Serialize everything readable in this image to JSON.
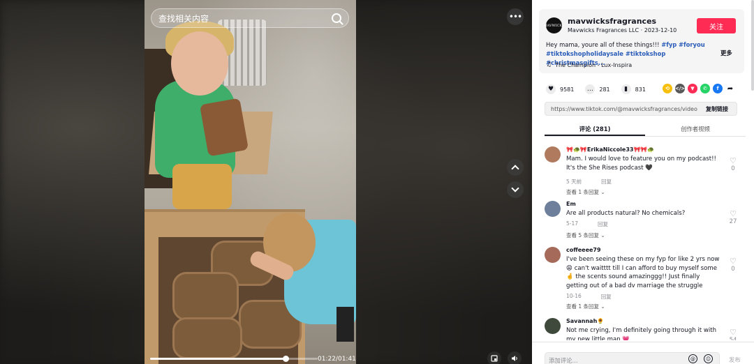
{
  "search": {
    "placeholder": "查找相关内容"
  },
  "player": {
    "time": "01:22/01:41",
    "progress_fraction": 0.81,
    "more_icon": "ellipsis-icon",
    "prev_icon": "chevron-up-icon",
    "next_icon": "chevron-down-icon",
    "pip_icon": "picture-in-picture-icon",
    "volume_icon": "speaker-icon"
  },
  "author": {
    "avatar_text": "MAVWICKS",
    "name": "mavwicksfragrances",
    "subtitle": "Mavwicks Fragrances LLC · 2023-12-10",
    "follow_label": "关注"
  },
  "post": {
    "desc_prefix": "Hey mama, youre all of these things!!! ",
    "tags_line1": [
      "#fyp",
      "#foryou"
    ],
    "tags_line2": "#tiktokshopholidaysale #tiktokshop #christmasgifts...",
    "more_label": "更多",
    "music": "The Champion - Lux-Inspira"
  },
  "stats": {
    "likes": "9581",
    "comments": "281",
    "saves": "831"
  },
  "share_colors": {
    "repost": "#f7c00f",
    "embed": "#595959",
    "direct": "#fe2c55",
    "whatsapp": "#25d366",
    "facebook": "#1877f2"
  },
  "link": {
    "url": "https://www.tiktok.com/@mavwicksfragrances/video/7...",
    "copy_label": "复制链接"
  },
  "tabs": [
    {
      "label": "评论 (281)"
    },
    {
      "label": "创作者视频"
    }
  ],
  "comments": [
    {
      "name": "🎀🐢🎀ErikaNiccole33🎀🎀🐢",
      "text": "Mam. I would love to feature you on my podcast!! It's the She Rises podcast 🖤",
      "time": "5 天前",
      "reply": "回复",
      "likes": "0",
      "more": "查看 1 条回复 ⌄",
      "avatar_color": "#b07a5e"
    },
    {
      "name": "Em",
      "text": "Are all products natural? No chemicals?",
      "time": "5-17",
      "reply": "回复",
      "likes": "27",
      "more": "查看 5 条回复 ⌄",
      "avatar_color": "#6e7f9b"
    },
    {
      "name": "coffeeee79",
      "text": "I've been seeing these on my fyp for like 2 yrs now 😩 can't waitttt till I can afford to buy myself some 🤞 the scents sound amazinggg!! Just finally getting out of a bad dv marriage the struggle",
      "time": "10-16",
      "reply": "回复",
      "likes": "0",
      "more": "查看 1 条回复 ⌄",
      "avatar_color": "#a56a5a"
    },
    {
      "name": "Savannah🌻",
      "text": "Not me crying, I'm definitely going through it with my new little man 💗",
      "time": "",
      "reply": "",
      "likes": "54",
      "more": "",
      "avatar_color": "#3f4a3c"
    }
  ],
  "input": {
    "placeholder": "添加评论...",
    "post_label": "发布"
  }
}
